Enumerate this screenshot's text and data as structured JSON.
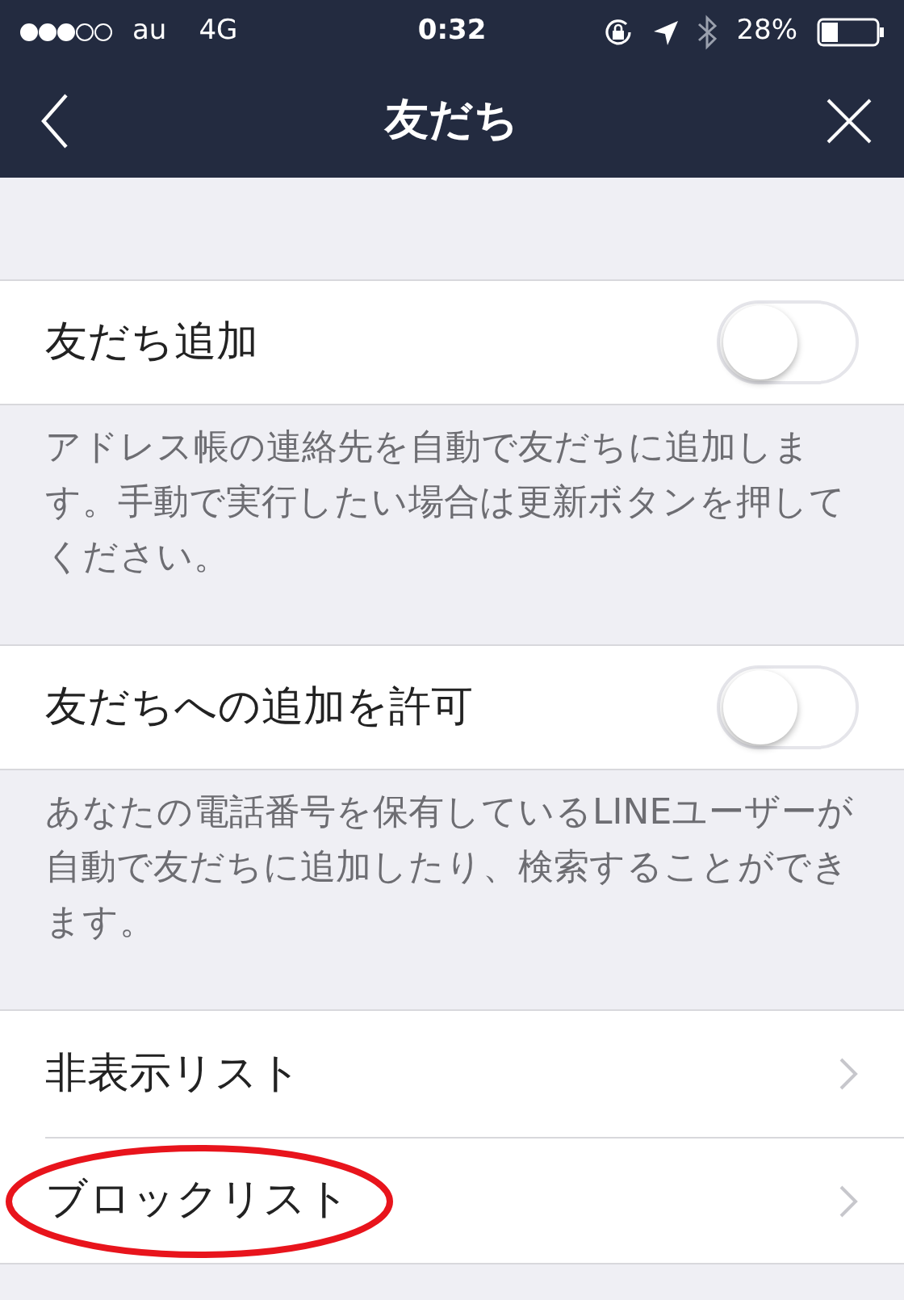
{
  "status_bar": {
    "carrier": "au",
    "network": "4G",
    "time": "0:32",
    "battery": "28%"
  },
  "nav": {
    "title": "友だち"
  },
  "sections": [
    {
      "label": "友だち追加",
      "on": false,
      "description": "アドレス帳の連絡先を自動で友だちに追加します。手動で実行したい場合は更新ボタンを押してください。"
    },
    {
      "label": "友だちへの追加を許可",
      "on": false,
      "description": "あなたの電話番号を保有しているLINEユーザーが自動で友だちに追加したり、検索することができます。"
    }
  ],
  "links": [
    {
      "label": "非表示リスト",
      "highlighted": false
    },
    {
      "label": "ブロックリスト",
      "highlighted": true
    }
  ]
}
